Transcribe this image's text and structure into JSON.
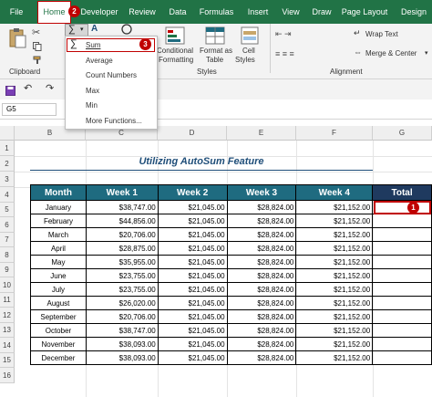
{
  "ribbon_tabs": [
    "File",
    "Home",
    "Developer",
    "Review",
    "Data",
    "Formulas",
    "Insert",
    "View",
    "Draw",
    "Page Layout",
    "Design"
  ],
  "ribbon": {
    "clipboard_label": "Clipboard",
    "conditional_formatting": [
      "Conditional",
      "Formatting"
    ],
    "format_as_table": [
      "Format as",
      "Table"
    ],
    "cell_styles": [
      "Cell",
      "Styles"
    ],
    "styles_label": "Styles",
    "wrap_text": "Wrap Text",
    "merge_center": "Merge & Center",
    "alignment_label": "Alignment"
  },
  "autosum_menu": [
    "Sum",
    "Average",
    "Count Numbers",
    "Max",
    "Min",
    "More Functions..."
  ],
  "name_box": "G5",
  "columns": [
    "B",
    "C",
    "D",
    "E",
    "F",
    "G"
  ],
  "rows": [
    "1",
    "2",
    "3",
    "4",
    "5",
    "6",
    "7",
    "8",
    "9",
    "10",
    "11",
    "12",
    "13",
    "14",
    "15",
    "16"
  ],
  "title": "Utilizing AutoSum Feature",
  "table": {
    "headers": [
      "Month",
      "Week 1",
      "Week 2",
      "Week 3",
      "Week 4",
      "Total"
    ],
    "rows": [
      [
        "January",
        "$38,747.00",
        "$21,045.00",
        "$28,824.00",
        "$21,152.00"
      ],
      [
        "February",
        "$44,856.00",
        "$21,045.00",
        "$28,824.00",
        "$21,152.00"
      ],
      [
        "March",
        "$20,706.00",
        "$21,045.00",
        "$28,824.00",
        "$21,152.00"
      ],
      [
        "April",
        "$28,875.00",
        "$21,045.00",
        "$28,824.00",
        "$21,152.00"
      ],
      [
        "May",
        "$35,955.00",
        "$21,045.00",
        "$28,824.00",
        "$21,152.00"
      ],
      [
        "June",
        "$23,755.00",
        "$21,045.00",
        "$28,824.00",
        "$21,152.00"
      ],
      [
        "July",
        "$23,755.00",
        "$21,045.00",
        "$28,824.00",
        "$21,152.00"
      ],
      [
        "August",
        "$26,020.00",
        "$21,045.00",
        "$28,824.00",
        "$21,152.00"
      ],
      [
        "September",
        "$20,706.00",
        "$21,045.00",
        "$28,824.00",
        "$21,152.00"
      ],
      [
        "October",
        "$38,747.00",
        "$21,045.00",
        "$28,824.00",
        "$21,152.00"
      ],
      [
        "November",
        "$38,093.00",
        "$21,045.00",
        "$28,824.00",
        "$21,152.00"
      ],
      [
        "December",
        "$38,093.00",
        "$21,045.00",
        "$28,824.00",
        "$21,152.00"
      ]
    ]
  },
  "badges": [
    "1",
    "2",
    "3"
  ],
  "colors": {
    "excel_green": "#217346",
    "header_teal": "#1f6b80",
    "header_navy": "#1f3a5f",
    "highlight_red": "#c00000"
  }
}
